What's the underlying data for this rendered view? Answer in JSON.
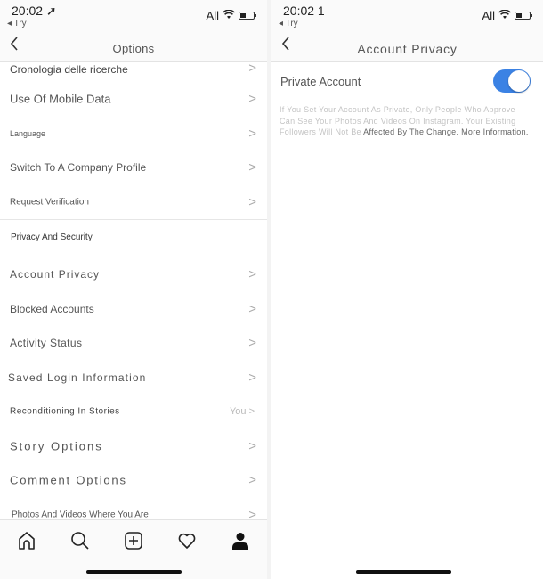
{
  "left_screen": {
    "status_bar": {
      "time": "20:02 ➚",
      "back_app": "◂ Try",
      "carrier": "All"
    },
    "nav": {
      "title": "Options",
      "back_icon": "chevron-left"
    },
    "items": [
      {
        "label": "Cronologia delle ricerche",
        "chevron": ">"
      },
      {
        "label": "Use Of Mobile Data",
        "chevron": ">"
      },
      {
        "label": "Language",
        "chevron": ">"
      },
      {
        "label": "Switch To A Company Profile",
        "chevron": ">"
      },
      {
        "label": "Request Verification",
        "chevron": ">"
      }
    ],
    "section_header": "Privacy And Security",
    "privacy_items": [
      {
        "label": "Account Privacy",
        "chevron": ">"
      },
      {
        "label": "Blocked Accounts",
        "chevron": ">"
      },
      {
        "label": "Activity Status",
        "chevron": ">"
      },
      {
        "label": "Saved Login Information",
        "chevron": ">"
      },
      {
        "label": "Reconditioning In Stories",
        "value": "You >"
      },
      {
        "label": "Story Options",
        "chevron": ">"
      },
      {
        "label": "Comment Options",
        "chevron": ">"
      },
      {
        "label": "Photos And Videos Where You Are",
        "chevron": ">"
      }
    ],
    "tab_bar": [
      "home-icon",
      "search-icon",
      "add-post-icon",
      "heart-icon",
      "profile-icon"
    ]
  },
  "right_screen": {
    "status_bar": {
      "time": "20:02 1",
      "back_app": "◂ Try",
      "carrier": "All"
    },
    "nav": {
      "title": "Account Privacy",
      "back_icon": "chevron-left"
    },
    "private_account": {
      "label": "Private Account",
      "enabled": true,
      "accent_color": "#3b82e4"
    },
    "description": "If You Set Your Account As Private, Only People Who Approve Can See Your Photos And Videos On Instagram. Your Existing Followers Will Not Be",
    "description_dark": "Affected By The Change.",
    "more_info_link": "More Information."
  }
}
